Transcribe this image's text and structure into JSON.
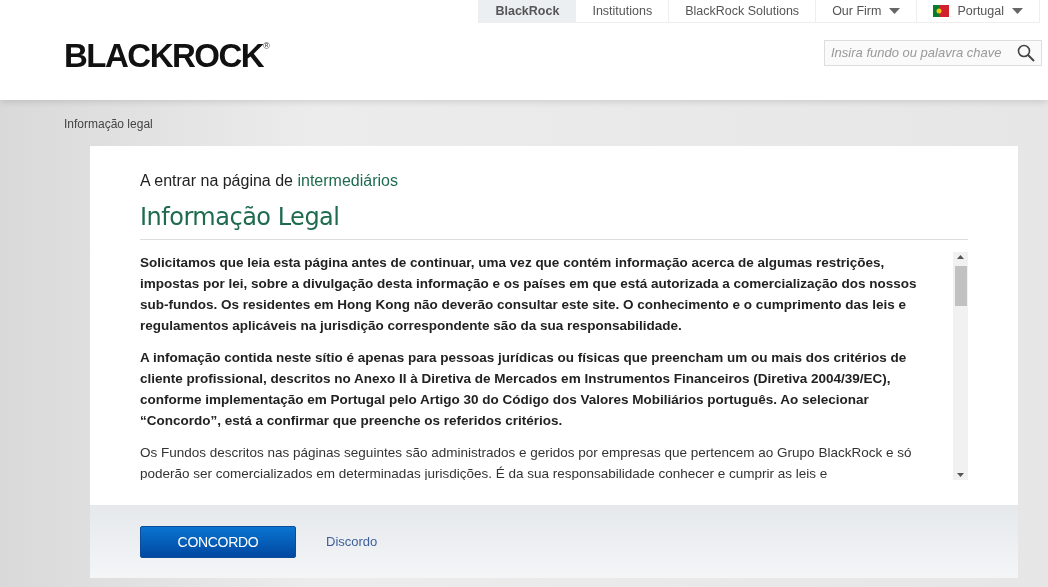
{
  "top_nav": [
    {
      "label": "BlackRock",
      "selected": true,
      "kind": "link"
    },
    {
      "label": "Institutions",
      "selected": false,
      "kind": "link"
    },
    {
      "label": "BlackRock Solutions",
      "selected": false,
      "kind": "link"
    },
    {
      "label": "Our Firm",
      "selected": false,
      "kind": "menu"
    },
    {
      "label": "Portugal",
      "selected": false,
      "kind": "country-menu"
    }
  ],
  "logo": {
    "text": "BLACKROCK",
    "mark": "®"
  },
  "search": {
    "placeholder": "Insira fundo ou palavra chave"
  },
  "breadcrumb": "Informação legal",
  "intro": {
    "text": "A entrar na página de",
    "link": "intermediários"
  },
  "title": "Informação Legal",
  "paragraphs": [
    {
      "kind": "bold",
      "text": "Solicitamos que leia esta página antes de continuar, uma vez que contém informação acerca de algumas restrições, impostas por lei, sobre a divulgação desta informação e os países em que está autorizada a comercialização dos nossos sub-fundos. Os residentes em Hong Kong não deverão consultar este site. O conhecimento e o cumprimento das leis e regulamentos aplicáveis na jurisdição correspondente são da sua responsabilidade."
    },
    {
      "kind": "bold",
      "text": "A infomação contida neste sítio é apenas para pessoas jurídicas ou físicas que preencham um ou mais dos critérios de cliente profissional, descritos no Anexo II à Diretiva de Mercados em Instrumentos Financeiros (Diretiva 2004/39/EC), conforme implementação em Portugal pelo Artigo 30 do Código dos Valores Mobiliários português. Ao selecionar “Concordo”, está a confirmar que preenche os referidos critérios."
    },
    {
      "kind": "normal",
      "text": "Os Fundos descritos nas páginas seguintes são administrados e geridos por empresas que pertencem ao Grupo BlackRock e só poderão ser comercializados em determinadas jurisdições. É da sua responsabilidade conhecer e cumprir as leis e"
    }
  ],
  "actions": {
    "agree": "CONCORDO",
    "disagree": "Discordo"
  }
}
